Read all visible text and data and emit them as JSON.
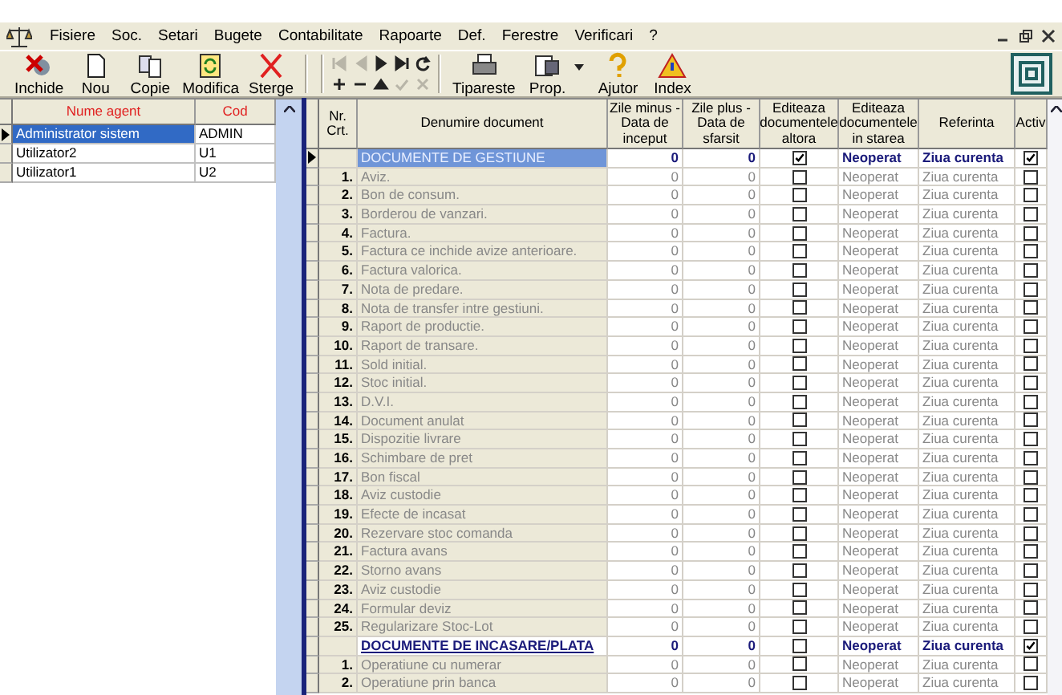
{
  "menu": [
    {
      "label": "Fisiere"
    },
    {
      "label": "Soc."
    },
    {
      "label": "Setari"
    },
    {
      "label": "Bugete"
    },
    {
      "label": "Contabilitate"
    },
    {
      "label": "Rapoarte"
    },
    {
      "label": "Def."
    },
    {
      "label": "Ferestre"
    },
    {
      "label": "Verificari"
    },
    {
      "label": "?"
    }
  ],
  "toolbar": [
    {
      "kind": "close",
      "label": "Inchide"
    },
    {
      "kind": "new",
      "label": "Nou"
    },
    {
      "kind": "copy",
      "label": "Copie"
    },
    {
      "kind": "edit",
      "label": "Modifica"
    },
    {
      "kind": "delete",
      "label": "Sterge"
    },
    {
      "kind": "nav"
    },
    {
      "kind": "print",
      "label": "Tipareste"
    },
    {
      "kind": "props",
      "label": "Prop."
    },
    {
      "kind": "help",
      "label": "Ajutor"
    },
    {
      "kind": "index",
      "label": "Index"
    }
  ],
  "nav": [
    {
      "kind": "first",
      "disabled": true
    },
    {
      "kind": "prev",
      "disabled": true
    },
    {
      "kind": "next",
      "disabled": false
    },
    {
      "kind": "last",
      "disabled": false
    },
    {
      "kind": "refresh",
      "disabled": false
    },
    {
      "kind": "add",
      "disabled": false
    },
    {
      "kind": "remove",
      "disabled": false
    },
    {
      "kind": "up",
      "disabled": false
    },
    {
      "kind": "confirm",
      "disabled": true
    },
    {
      "kind": "cancel",
      "disabled": true
    }
  ],
  "agents": {
    "columns": [
      "Nume agent",
      "Cod"
    ],
    "rows": [
      {
        "name": "Administrator sistem",
        "code": "ADMIN",
        "selected": true
      },
      {
        "name": "Utilizator2",
        "code": "U1",
        "selected": false
      },
      {
        "name": "Utilizator1",
        "code": "U2",
        "selected": false
      }
    ]
  },
  "documents": {
    "columns": [
      "Nr. Crt.",
      "Denumire document",
      "Zile minus - Data de inceput",
      "Zile plus - Data de sfarsit",
      "Editeaza documentele altora",
      "Editeaza documentele in starea",
      "Referinta",
      "Activ"
    ],
    "rows": [
      {
        "kind": "group",
        "nr": "",
        "name": "DOCUMENTE DE GESTIUNE",
        "minus": "0",
        "plus": "0",
        "edit_others": true,
        "state": "Neoperat",
        "ref": "Ziua curenta",
        "active": true,
        "selected": true,
        "underlined": false
      },
      {
        "kind": "item",
        "nr": "1.",
        "name": "Aviz.",
        "minus": "0",
        "plus": "0",
        "edit_others": false,
        "state": "Neoperat",
        "ref": "Ziua curenta",
        "active": false,
        "selected": false
      },
      {
        "kind": "item",
        "nr": "2.",
        "name": "Bon de consum.",
        "minus": "0",
        "plus": "0",
        "edit_others": false,
        "state": "Neoperat",
        "ref": "Ziua curenta",
        "active": false,
        "selected": false
      },
      {
        "kind": "item",
        "nr": "3.",
        "name": "Borderou de vanzari.",
        "minus": "0",
        "plus": "0",
        "edit_others": false,
        "state": "Neoperat",
        "ref": "Ziua curenta",
        "active": false,
        "selected": false
      },
      {
        "kind": "item",
        "nr": "4.",
        "name": "Factura.",
        "minus": "0",
        "plus": "0",
        "edit_others": false,
        "state": "Neoperat",
        "ref": "Ziua curenta",
        "active": false,
        "selected": false
      },
      {
        "kind": "item",
        "nr": "5.",
        "name": "Factura ce inchide avize anterioare.",
        "minus": "0",
        "plus": "0",
        "edit_others": false,
        "state": "Neoperat",
        "ref": "Ziua curenta",
        "active": false,
        "selected": false
      },
      {
        "kind": "item",
        "nr": "6.",
        "name": "Factura valorica.",
        "minus": "0",
        "plus": "0",
        "edit_others": false,
        "state": "Neoperat",
        "ref": "Ziua curenta",
        "active": false,
        "selected": false
      },
      {
        "kind": "item",
        "nr": "7.",
        "name": "Nota de predare.",
        "minus": "0",
        "plus": "0",
        "edit_others": false,
        "state": "Neoperat",
        "ref": "Ziua curenta",
        "active": false,
        "selected": false
      },
      {
        "kind": "item",
        "nr": "8.",
        "name": "Nota de transfer intre gestiuni.",
        "minus": "0",
        "plus": "0",
        "edit_others": false,
        "state": "Neoperat",
        "ref": "Ziua curenta",
        "active": false,
        "selected": false
      },
      {
        "kind": "item",
        "nr": "9.",
        "name": "Raport de productie.",
        "minus": "0",
        "plus": "0",
        "edit_others": false,
        "state": "Neoperat",
        "ref": "Ziua curenta",
        "active": false,
        "selected": false
      },
      {
        "kind": "item",
        "nr": "10.",
        "name": "Raport de transare.",
        "minus": "0",
        "plus": "0",
        "edit_others": false,
        "state": "Neoperat",
        "ref": "Ziua curenta",
        "active": false,
        "selected": false
      },
      {
        "kind": "item",
        "nr": "11.",
        "name": "Sold initial.",
        "minus": "0",
        "plus": "0",
        "edit_others": false,
        "state": "Neoperat",
        "ref": "Ziua curenta",
        "active": false,
        "selected": false
      },
      {
        "kind": "item",
        "nr": "12.",
        "name": "Stoc initial.",
        "minus": "0",
        "plus": "0",
        "edit_others": false,
        "state": "Neoperat",
        "ref": "Ziua curenta",
        "active": false,
        "selected": false
      },
      {
        "kind": "item",
        "nr": "13.",
        "name": "D.V.I.",
        "minus": "0",
        "plus": "0",
        "edit_others": false,
        "state": "Neoperat",
        "ref": "Ziua curenta",
        "active": false,
        "selected": false
      },
      {
        "kind": "item",
        "nr": "14.",
        "name": "Document anulat",
        "minus": "0",
        "plus": "0",
        "edit_others": false,
        "state": "Neoperat",
        "ref": "Ziua curenta",
        "active": false,
        "selected": false
      },
      {
        "kind": "item",
        "nr": "15.",
        "name": "Dispozitie livrare",
        "minus": "0",
        "plus": "0",
        "edit_others": false,
        "state": "Neoperat",
        "ref": "Ziua curenta",
        "active": false,
        "selected": false
      },
      {
        "kind": "item",
        "nr": "16.",
        "name": "Schimbare de pret",
        "minus": "0",
        "plus": "0",
        "edit_others": false,
        "state": "Neoperat",
        "ref": "Ziua curenta",
        "active": false,
        "selected": false
      },
      {
        "kind": "item",
        "nr": "17.",
        "name": "Bon fiscal",
        "minus": "0",
        "plus": "0",
        "edit_others": false,
        "state": "Neoperat",
        "ref": "Ziua curenta",
        "active": false,
        "selected": false
      },
      {
        "kind": "item",
        "nr": "18.",
        "name": "Aviz custodie",
        "minus": "0",
        "plus": "0",
        "edit_others": false,
        "state": "Neoperat",
        "ref": "Ziua curenta",
        "active": false,
        "selected": false
      },
      {
        "kind": "item",
        "nr": "19.",
        "name": "Efecte de incasat",
        "minus": "0",
        "plus": "0",
        "edit_others": false,
        "state": "Neoperat",
        "ref": "Ziua curenta",
        "active": false,
        "selected": false
      },
      {
        "kind": "item",
        "nr": "20.",
        "name": "Rezervare stoc comanda",
        "minus": "0",
        "plus": "0",
        "edit_others": false,
        "state": "Neoperat",
        "ref": "Ziua curenta",
        "active": false,
        "selected": false
      },
      {
        "kind": "item",
        "nr": "21.",
        "name": "Factura avans",
        "minus": "0",
        "plus": "0",
        "edit_others": false,
        "state": "Neoperat",
        "ref": "Ziua curenta",
        "active": false,
        "selected": false
      },
      {
        "kind": "item",
        "nr": "22.",
        "name": "Storno avans",
        "minus": "0",
        "plus": "0",
        "edit_others": false,
        "state": "Neoperat",
        "ref": "Ziua curenta",
        "active": false,
        "selected": false
      },
      {
        "kind": "item",
        "nr": "23.",
        "name": "Aviz custodie",
        "minus": "0",
        "plus": "0",
        "edit_others": false,
        "state": "Neoperat",
        "ref": "Ziua curenta",
        "active": false,
        "selected": false
      },
      {
        "kind": "item",
        "nr": "24.",
        "name": "Formular deviz",
        "minus": "0",
        "plus": "0",
        "edit_others": false,
        "state": "Neoperat",
        "ref": "Ziua curenta",
        "active": false,
        "selected": false
      },
      {
        "kind": "item",
        "nr": "25.",
        "name": "Regularizare Stoc-Lot",
        "minus": "0",
        "plus": "0",
        "edit_others": false,
        "state": "Neoperat",
        "ref": "Ziua curenta",
        "active": false,
        "selected": false
      },
      {
        "kind": "group",
        "nr": "",
        "name": "DOCUMENTE DE INCASARE/PLATA",
        "minus": "0",
        "plus": "0",
        "edit_others": false,
        "state": "Neoperat",
        "ref": "Ziua curenta",
        "active": true,
        "selected": false,
        "underlined": true
      },
      {
        "kind": "item",
        "nr": "1.",
        "name": "Operatiune cu numerar",
        "minus": "0",
        "plus": "0",
        "edit_others": false,
        "state": "Neoperat",
        "ref": "Ziua curenta",
        "active": false,
        "selected": false
      },
      {
        "kind": "item",
        "nr": "2.",
        "name": "Operatiune prin banca",
        "minus": "0",
        "plus": "0",
        "edit_others": false,
        "state": "Neoperat",
        "ref": "Ziua curenta",
        "active": false,
        "selected": false
      }
    ]
  }
}
